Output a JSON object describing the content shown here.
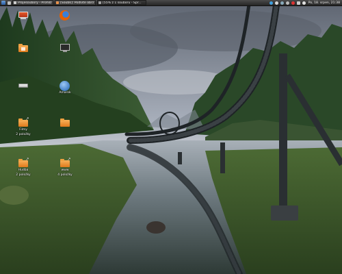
{
  "panel": {
    "tasks": [
      {
        "label": "Projesoubory - Prohlíž...",
        "color": "#cfcfcf"
      },
      {
        "label": "[Soubk]: Podívte obráz...",
        "color": "#e8904a"
      },
      {
        "label": "[55% z 1 souboru - Spr...",
        "color": "#a0a0a0"
      }
    ],
    "clock": "Po, 18. srpen, 21:38"
  },
  "desktop": {
    "icons": [
      {
        "id": "computer",
        "label": "",
        "type": "computer"
      },
      {
        "id": "firefox",
        "label": "",
        "type": "firefox"
      },
      {
        "id": "home",
        "label": "",
        "type": "folder"
      },
      {
        "id": "terminal",
        "label": "",
        "type": "monitor"
      },
      {
        "id": "drive",
        "label": "",
        "type": "drive"
      },
      {
        "id": "amarok",
        "label": "Amarok",
        "type": "globe"
      },
      {
        "id": "filmy",
        "label": "Filmy",
        "sub": "2 položky",
        "type": "folder-link"
      },
      {
        "id": "folder2",
        "label": "",
        "type": "folder"
      },
      {
        "id": "hudba",
        "label": "Hudba",
        "sub": "2 položky",
        "type": "folder-link"
      },
      {
        "id": "www",
        "label": "www",
        "sub": "4 položky",
        "type": "folder-link"
      }
    ]
  },
  "colors": {
    "panel_bg": "#2e2e2e",
    "folder": "#f0a040",
    "firefox": "#e66000",
    "sky": "#b4bcc8",
    "forest": "#2c4a2a"
  }
}
